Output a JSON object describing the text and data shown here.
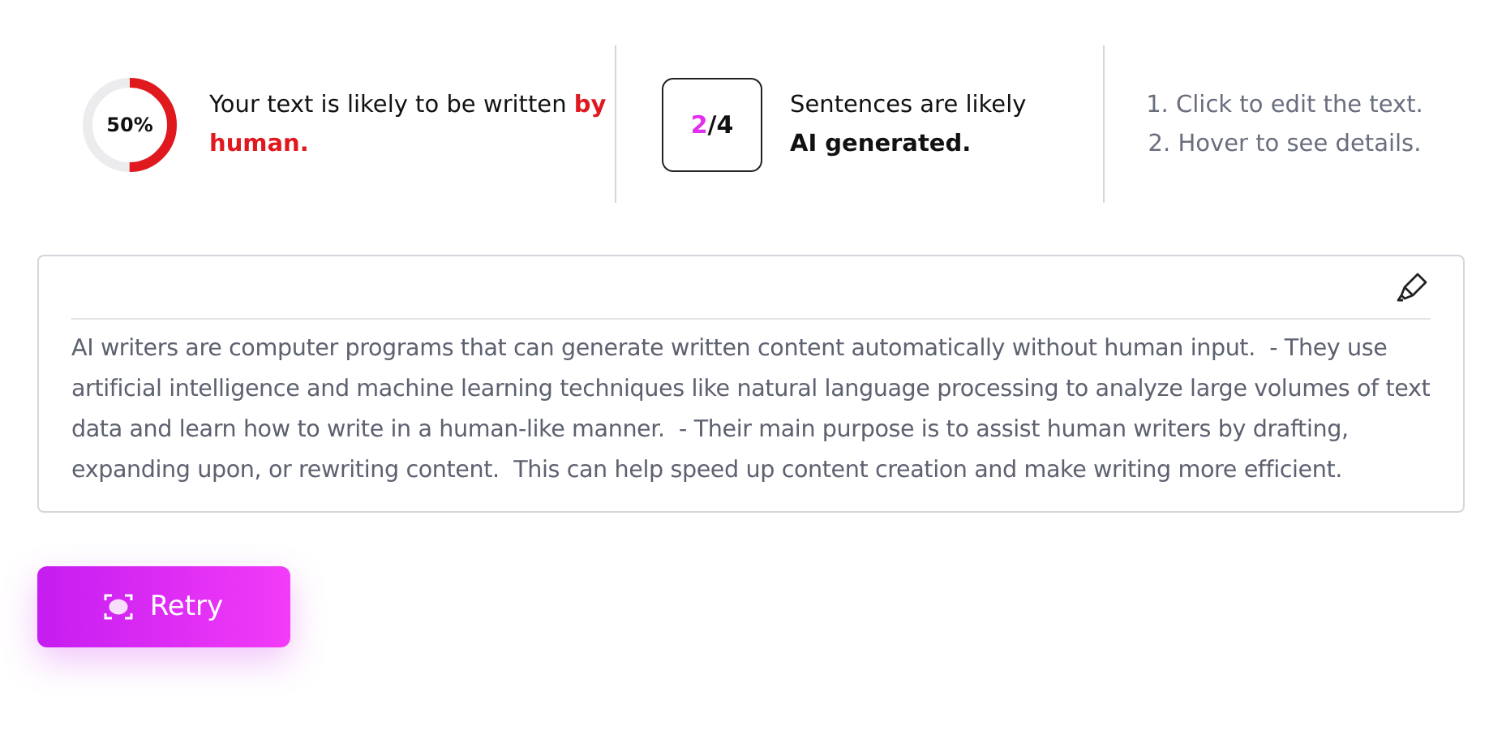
{
  "summary": {
    "gauge": {
      "label": "50%",
      "level": 0.5
    },
    "message": "Your text is likely to be written",
    "verdict": "by human."
  },
  "sentences": {
    "flagged": "2",
    "rest": "/4",
    "message": "Sentences are likely",
    "emphasis": "AI generated."
  },
  "tips": [
    "1. Click to edit the text.",
    "2. Hover to see details."
  ],
  "editor": {
    "text": "AI writers are computer programs that can generate written content automatically without human input.  - They use artificial intelligence and machine learning techniques like natural language processing to analyze large volumes of text data and learn how to write in a human-like manner.  - Their main purpose is to assist human writers by drafting, expanding upon, or rewriting content.  This can help speed up content creation and make writing more efficient."
  },
  "retry_button": {
    "label": "Retry"
  }
}
